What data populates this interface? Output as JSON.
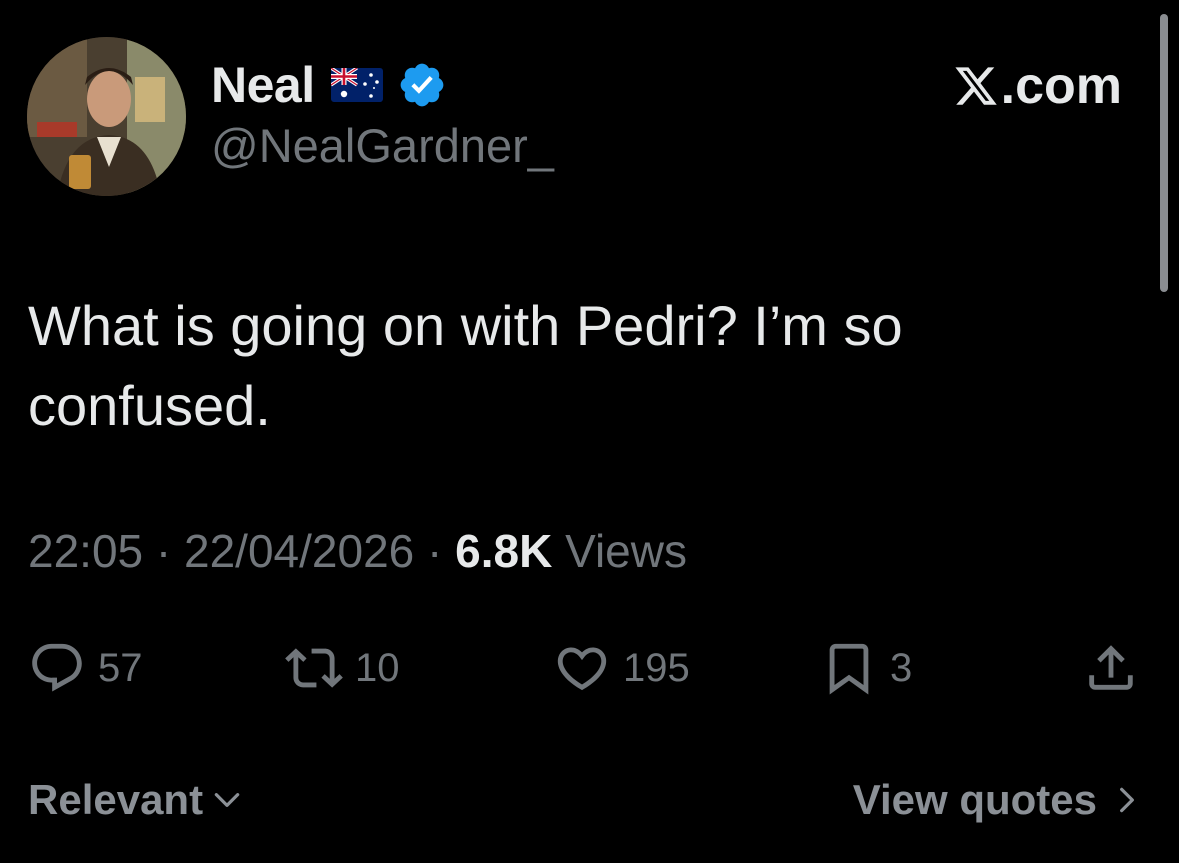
{
  "author": {
    "display_name": "Neal",
    "flag_icon": "australia-flag-icon",
    "verified_icon": "verified-badge-icon",
    "handle": "@NealGardner_",
    "avatar_icon": "profile-photo"
  },
  "source": {
    "label": ".com",
    "logo_icon": "x-logo-icon"
  },
  "tweet": {
    "text": "What is going on with Pedri? I’m so confused.",
    "time": "22:05",
    "date": "22/04/2026",
    "views_count": "6.8K",
    "views_label": "Views",
    "separator": "·"
  },
  "actions": {
    "reply": {
      "icon": "reply-icon",
      "count": "57"
    },
    "repost": {
      "icon": "repost-icon",
      "count": "10"
    },
    "like": {
      "icon": "heart-icon",
      "count": "195"
    },
    "bookmark": {
      "icon": "bookmark-icon",
      "count": "3"
    },
    "share": {
      "icon": "share-icon"
    }
  },
  "footer": {
    "sort_label": "Relevant",
    "quotes_label": "View quotes"
  },
  "colors": {
    "background": "#000000",
    "primary_text": "#e7e9ea",
    "secondary_text": "#71767b",
    "verified_blue": "#1d9bf0"
  }
}
